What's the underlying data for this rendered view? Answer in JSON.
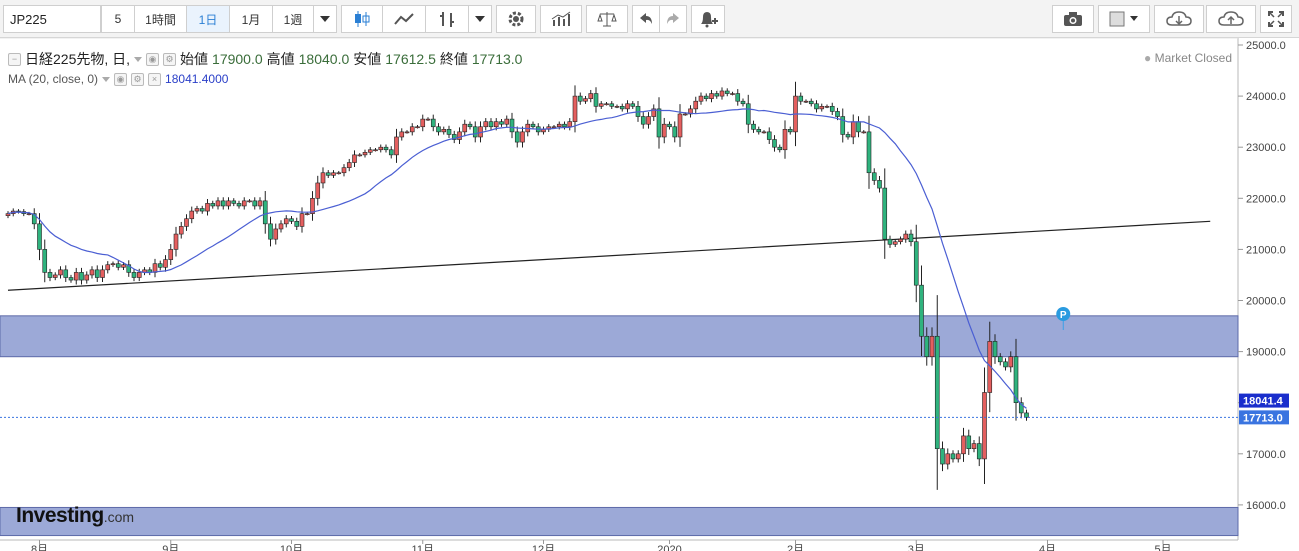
{
  "toolbar": {
    "symbol": "JP225",
    "interval_minutes": "5",
    "interval_hour": "1時間",
    "interval_day": "1日",
    "interval_month": "1月",
    "interval_week": "1週"
  },
  "legend": {
    "title": "日経225先物, 日,",
    "open_label": "始値",
    "open_value": "17900.0",
    "high_label": "高値",
    "high_value": "18040.0",
    "low_label": "安値",
    "low_value": "17612.5",
    "close_label": "終値",
    "close_value": "17713.0",
    "ma_label": "MA (20, close, 0)",
    "ma_value": "18041.4000"
  },
  "status": "Market Closed",
  "logo_main": "Investing",
  "logo_suffix": ".com",
  "colors": {
    "up": "#e45f5f",
    "down": "#2fb37e",
    "ma": "#4b5fd3",
    "zone": "#8b9ad0",
    "accent": "#2a7fd4",
    "ma_tag": "#1a2ecc",
    "price_tag": "#3a74e0"
  },
  "icons": [
    "dropdown-icon",
    "candles-icon",
    "line-chart-icon",
    "bar-style-icon",
    "gear-icon",
    "indicators-icon",
    "scale-icon",
    "undo-icon",
    "redo-icon",
    "alert-icon",
    "camera-icon",
    "color-square-icon",
    "cloud-download-icon",
    "cloud-upload-icon",
    "fullscreen-icon"
  ],
  "chart_data": {
    "type": "line",
    "ylim": [
      15400,
      25000
    ],
    "y_ticks": [
      "25000.0",
      "24000.0",
      "23000.0",
      "22000.0",
      "21000.0",
      "20000.0",
      "19000.0",
      "18000.0",
      "17000.0",
      "16000.0"
    ],
    "y_tick_values": [
      25000,
      24000,
      23000,
      22000,
      21000,
      20000,
      19000,
      18000,
      17000,
      16000
    ],
    "x_ticks": [
      "8月",
      "9月",
      "10月",
      "11月",
      "12月",
      "2020",
      "2月",
      "3月",
      "4月",
      "5月"
    ],
    "x_tick_index": [
      6,
      31,
      54,
      79,
      102,
      126,
      150,
      173,
      198,
      220
    ],
    "closes": [
      21700,
      21750,
      21740,
      21700,
      21700,
      21500,
      21000,
      20550,
      20450,
      20500,
      20600,
      20450,
      20400,
      20550,
      20400,
      20500,
      20600,
      20450,
      20600,
      20700,
      20720,
      20650,
      20700,
      20550,
      20450,
      20550,
      20600,
      20550,
      20720,
      20650,
      20800,
      21000,
      21300,
      21450,
      21600,
      21750,
      21800,
      21750,
      21900,
      21850,
      21950,
      21850,
      21950,
      21900,
      21850,
      21950,
      21950,
      21850,
      21950,
      21500,
      21200,
      21400,
      21500,
      21600,
      21550,
      21450,
      21700,
      21700,
      22000,
      22300,
      22500,
      22450,
      22500,
      22500,
      22600,
      22700,
      22850,
      22850,
      22900,
      22950,
      22950,
      23000,
      22950,
      22850,
      23200,
      23300,
      23300,
      23400,
      23400,
      23550,
      23550,
      23400,
      23300,
      23350,
      23250,
      23150,
      23300,
      23450,
      23400,
      23200,
      23400,
      23500,
      23400,
      23500,
      23450,
      23550,
      23300,
      23100,
      23300,
      23450,
      23400,
      23300,
      23350,
      23400,
      23400,
      23450,
      23400,
      23500,
      24000,
      23900,
      23950,
      24050,
      23800,
      23850,
      23850,
      23800,
      23800,
      23750,
      23850,
      23800,
      23600,
      23450,
      23600,
      23750,
      23200,
      23450,
      23400,
      23200,
      23650,
      23650,
      23750,
      23900,
      24000,
      23950,
      24050,
      24000,
      24100,
      24050,
      24050,
      23900,
      23850,
      23450,
      23350,
      23300,
      23300,
      23150,
      23000,
      22950,
      23350,
      23300,
      24000,
      23900,
      23900,
      23850,
      23750,
      23800,
      23800,
      23700,
      23600,
      23250,
      23200,
      23500,
      23300,
      23300,
      22500,
      22350,
      22200,
      21200,
      21100,
      21150,
      21200,
      21300,
      21150,
      20300,
      19300,
      18900,
      19300,
      17100,
      16800,
      17000,
      16900,
      17000,
      17350,
      17100,
      17200,
      16900,
      18200,
      19200,
      18900,
      18800,
      18700,
      18900,
      18000,
      17800,
      17713
    ],
    "ma20_value": 18041.4,
    "last_close": 17713.0,
    "ma20_tag": "18041.4",
    "close_tag": "17713.0",
    "zone_upper": [
      18900,
      19700
    ],
    "zone_lower": [
      15400,
      15950
    ],
    "trendline": {
      "start": [
        0,
        20200
      ],
      "end": [
        229,
        21550
      ]
    },
    "marker_label": "P"
  }
}
